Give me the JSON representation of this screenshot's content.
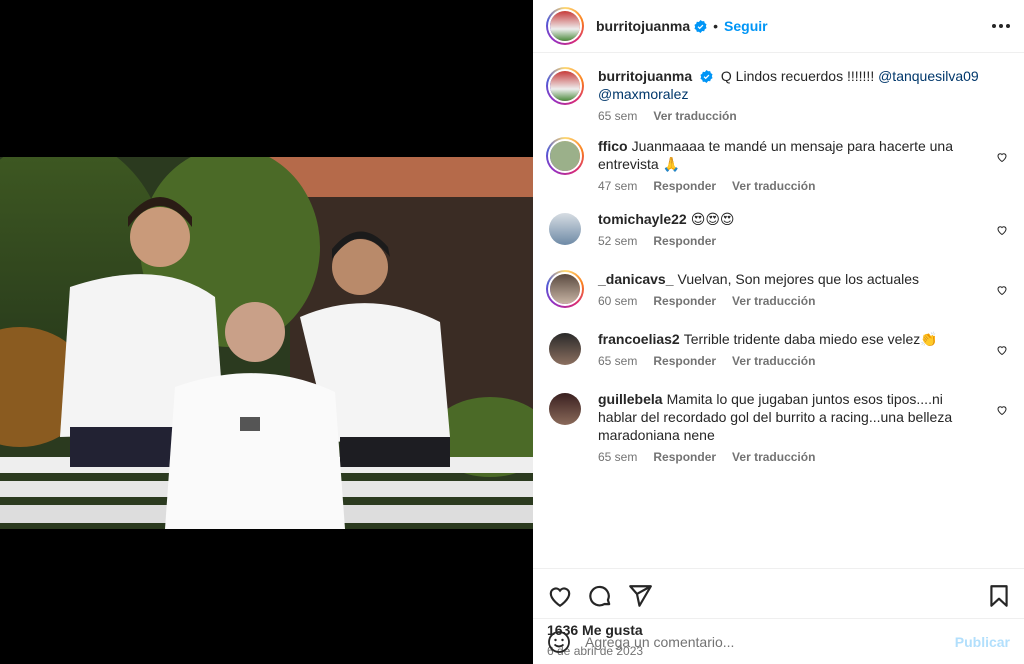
{
  "post": {
    "username": "burritojuanma",
    "follow_label": "Seguir",
    "caption_user": "burritojuanma",
    "caption_text": "Q Lindos recuerdos !!!!!!!",
    "caption_mention_1": "@tanquesilva09",
    "caption_mention_2": "@maxmoralez",
    "caption_time": "65 sem",
    "caption_translate": "Ver traducción"
  },
  "comments": [
    {
      "user": "ffico",
      "text": "Juanmaaaa te mandé un mensaje para hacerte una entrevista 🙏",
      "time": "47 sem",
      "reply": "Responder",
      "translate": "Ver traducción"
    },
    {
      "user": "tomichayle22",
      "text": "😍😍😍",
      "time": "52 sem",
      "reply": "Responder"
    },
    {
      "user": "_danicavs_",
      "text": "Vuelvan, Son mejores que los actuales",
      "time": "60 sem",
      "reply": "Responder",
      "translate": "Ver traducción"
    },
    {
      "user": "francoelias2",
      "text": "Terrible tridente daba miedo ese velez👏",
      "time": "65 sem",
      "reply": "Responder",
      "translate": "Ver traducción"
    },
    {
      "user": "guillebela",
      "text": "Mamita lo que jugaban juntos esos tipos....ni hablar del recordado gol del burrito a racing...una belleza maradoniana nene",
      "time": "65 sem",
      "reply": "Responder",
      "translate": "Ver traducción"
    }
  ],
  "footer": {
    "likes": "1636 Me gusta",
    "date": "6 de abril de 2023",
    "comment_placeholder": "Agrega un comentario...",
    "publish": "Publicar"
  },
  "colors": {
    "accent": "#0095f6",
    "verified": "#0095f6",
    "publish_disabled": "#b2dffc"
  }
}
